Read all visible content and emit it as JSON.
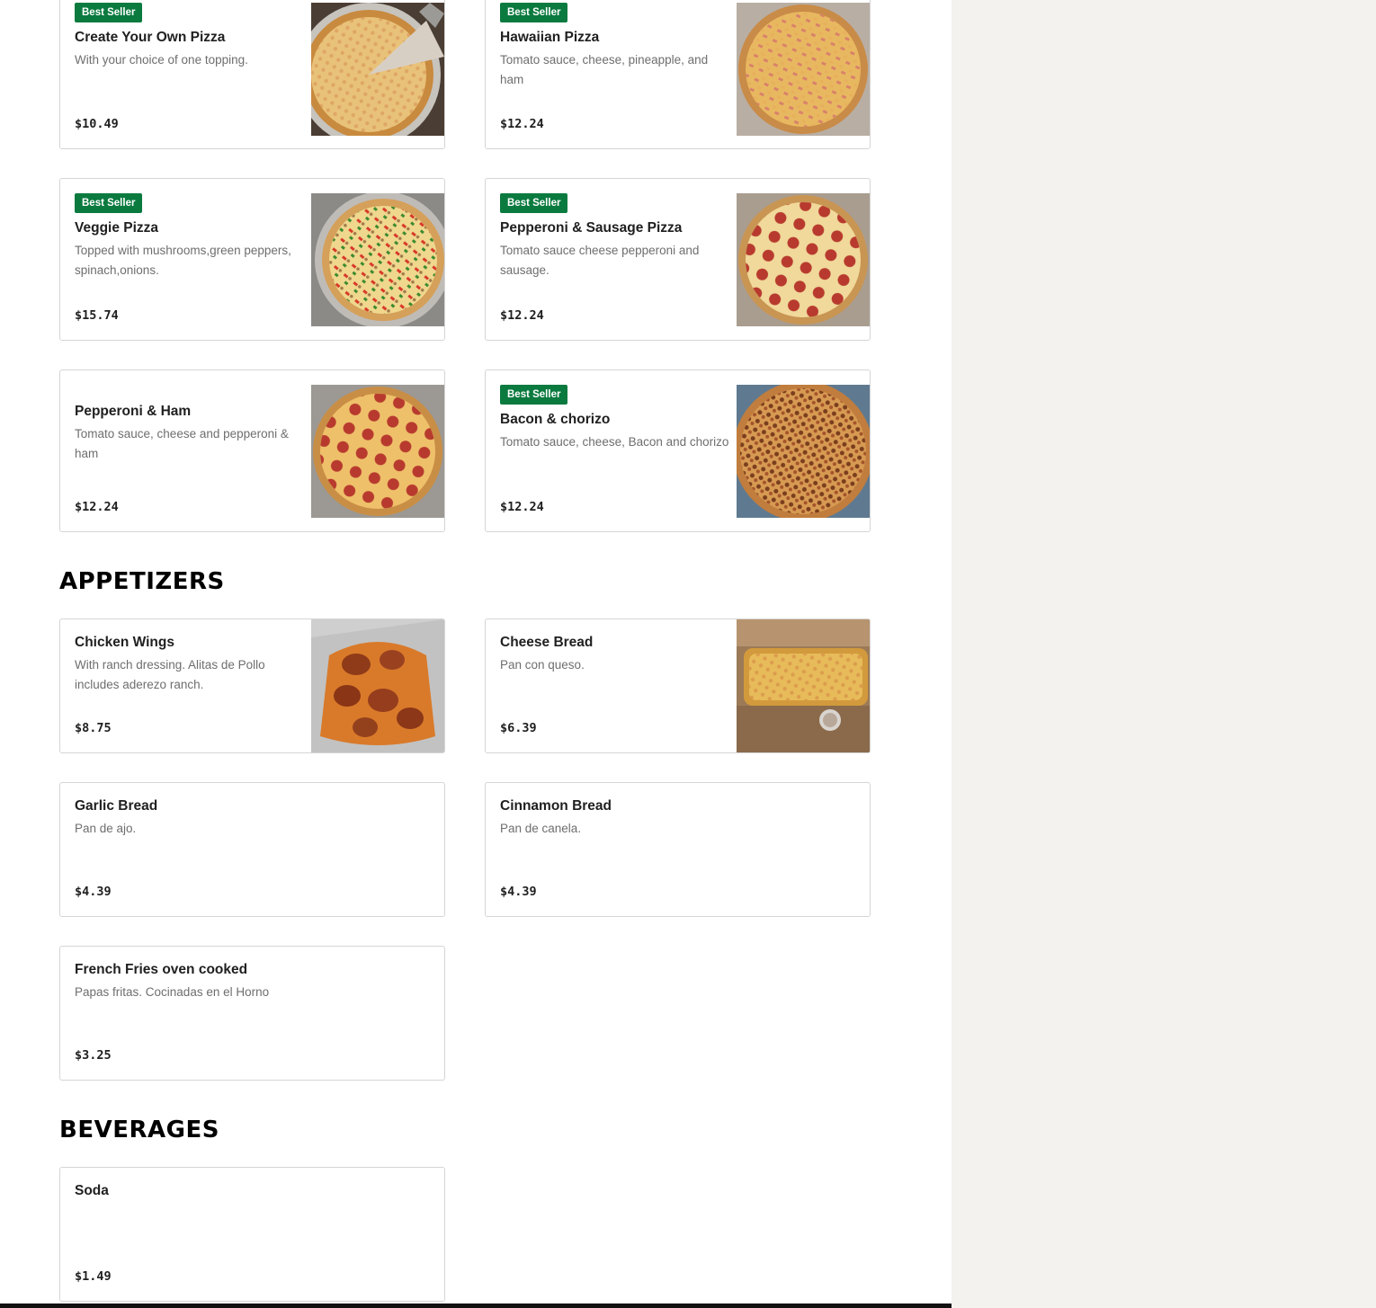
{
  "colors": {
    "badge_bg": "#0b7a3f",
    "side_panel": "#f3f2ef"
  },
  "sections": {
    "appetizers": "APPETIZERS",
    "beverages": "BEVERAGES"
  },
  "pizzas": [
    {
      "badge": "Best Seller",
      "name": "Create Your Own Pizza",
      "description": "With your choice of one topping.",
      "price": "$10.49",
      "image": "cheese-pizza-photo"
    },
    {
      "badge": "Best Seller",
      "name": "Hawaiian Pizza",
      "description": "Tomato sauce, cheese, pineapple, and ham",
      "price": "$12.24",
      "image": "hawaiian-pizza-photo"
    },
    {
      "badge": "Best Seller",
      "name": "Veggie Pizza",
      "description": "Topped with mushrooms,green peppers, spinach,onions.",
      "price": "$15.74",
      "image": "veggie-pizza-photo"
    },
    {
      "badge": "Best Seller",
      "name": "Pepperoni & Sausage Pizza",
      "description": "Tomato sauce cheese pepperoni and sausage.",
      "price": "$12.24",
      "image": "pepperoni-sausage-pizza-photo"
    },
    {
      "name": "Pepperoni & Ham",
      "description": "Tomato sauce, cheese and pepperoni & ham",
      "price": "$12.24",
      "image": "pepperoni-ham-pizza-photo"
    },
    {
      "badge": "Best Seller",
      "name": "Bacon & chorizo",
      "description": "Tomato sauce, cheese, Bacon and chorizo",
      "price": "$12.24",
      "image": "bacon-chorizo-pizza-photo"
    }
  ],
  "appetizers": [
    {
      "name": "Chicken Wings",
      "description": "With ranch dressing. Alitas de Pollo includes aderezo ranch.",
      "price": "$8.75",
      "image": "chicken-wings-photo"
    },
    {
      "name": "Cheese Bread",
      "description": "Pan con queso.",
      "price": "$6.39",
      "image": "cheese-bread-photo"
    },
    {
      "name": "Garlic Bread",
      "description": "Pan de ajo.",
      "price": "$4.39"
    },
    {
      "name": "Cinnamon Bread",
      "description": "Pan de canela.",
      "price": "$4.39"
    },
    {
      "name": "French Fries oven cooked",
      "description": "Papas fritas. Cocinadas en el Horno",
      "price": "$3.25"
    }
  ],
  "beverages": [
    {
      "name": "Soda",
      "price": "$1.49"
    }
  ]
}
